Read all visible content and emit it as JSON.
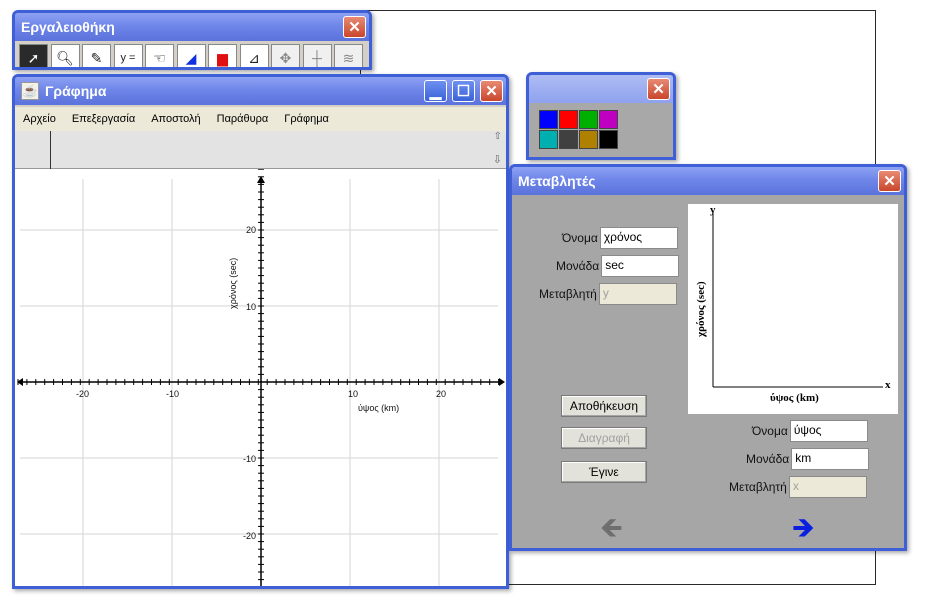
{
  "toolbox": {
    "title": "Εργαλειοθήκη",
    "tools": [
      {
        "icon": "arrow-pointer-icon",
        "glyph": "➚"
      },
      {
        "icon": "magnifier-icon",
        "glyph": "🔍︎"
      },
      {
        "icon": "pencil-icon",
        "glyph": "✎"
      },
      {
        "icon": "equation-icon",
        "glyph": "y ="
      },
      {
        "icon": "hand-icon",
        "glyph": "☜"
      },
      {
        "icon": "triangle-icon",
        "glyph": "◢"
      },
      {
        "icon": "bar-chart-icon",
        "glyph": "▆"
      },
      {
        "icon": "ruler-icon",
        "glyph": "⊿"
      },
      {
        "icon": "move-arrows-icon",
        "glyph": "✥"
      },
      {
        "icon": "crosshair-icon",
        "glyph": "┼"
      },
      {
        "icon": "spring-icon",
        "glyph": "≋"
      }
    ]
  },
  "graph_window": {
    "title": "Γράφημα",
    "menu": [
      "Αρχείο",
      "Επεξεργασία",
      "Αποστολή",
      "Παράθυρα",
      "Γράφημα"
    ],
    "x_axis_label": "ύψος (km)",
    "y_axis_label": "χρόνος (sec)",
    "x_ticks": [
      "-20",
      "-10",
      "10",
      "20"
    ],
    "y_ticks": [
      "20",
      "10",
      "-10",
      "-20"
    ]
  },
  "color_palette": {
    "colors": [
      "#0000ff",
      "#ff0000",
      "#00b000",
      "#c000c0",
      "#00b0b0",
      "#404040",
      "#b08000",
      "#000000"
    ]
  },
  "variables_window": {
    "title": "Μεταβλητές",
    "y_var": {
      "name_label": "Όνομα",
      "name_value": "χρόνος",
      "unit_label": "Μονάδα",
      "unit_value": "sec",
      "var_label": "Μεταβλητή",
      "var_value": "y"
    },
    "x_var": {
      "name_label": "Όνομα",
      "name_value": "ύψος",
      "unit_label": "Μονάδα",
      "unit_value": "km",
      "var_label": "Μεταβλητή",
      "var_value": "x"
    },
    "preview": {
      "y_letter": "y",
      "x_letter": "x",
      "y_label": "χρόνος (sec)",
      "x_label": "ύψος (km)"
    },
    "buttons": {
      "save": "Αποθήκευση",
      "delete": "Διαγραφή",
      "done": "Έγινε"
    }
  }
}
